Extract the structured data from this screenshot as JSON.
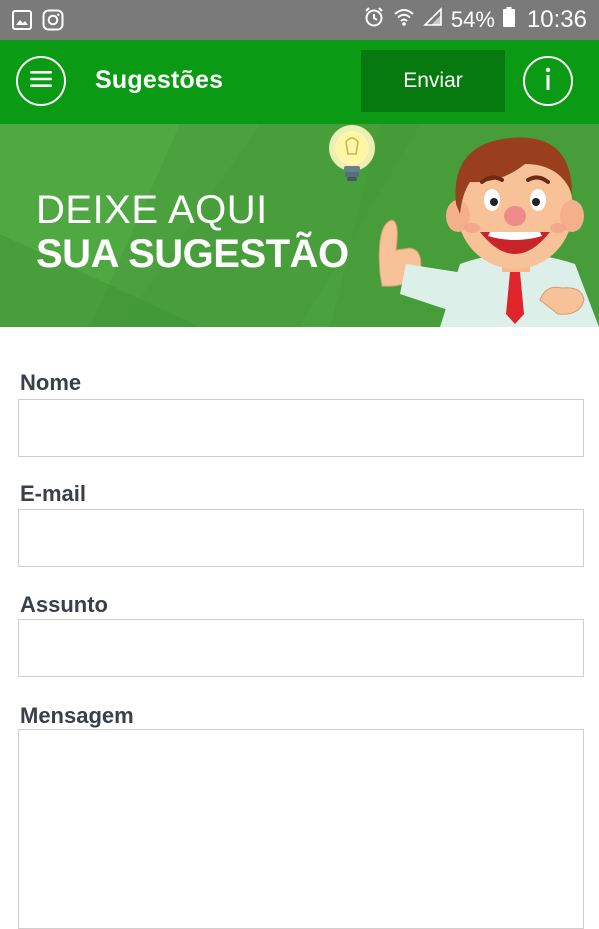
{
  "status_bar": {
    "battery_percent": "54%",
    "time": "10:36",
    "icons": [
      "image-icon",
      "instagram-icon",
      "alarm-icon",
      "wifi-icon",
      "signal-icon",
      "battery-icon"
    ]
  },
  "app_bar": {
    "title": "Sugestões",
    "send_label": "Enviar",
    "menu_icon": "hamburger-menu-icon",
    "info_icon": "info-icon"
  },
  "banner": {
    "line1": "DEIXE AQUI",
    "line2": "SUA SUGESTÃO"
  },
  "form": {
    "name_label": "Nome",
    "name_value": "",
    "email_label": "E-mail",
    "email_value": "",
    "subject_label": "Assunto",
    "subject_value": "",
    "message_label": "Mensagem",
    "message_value": ""
  },
  "colors": {
    "app_bar": "#0a9a14",
    "send_button": "#067a0f",
    "banner": "#4aa23e",
    "status_bar": "#7a7a7a",
    "label_text": "#3b3f4a"
  }
}
